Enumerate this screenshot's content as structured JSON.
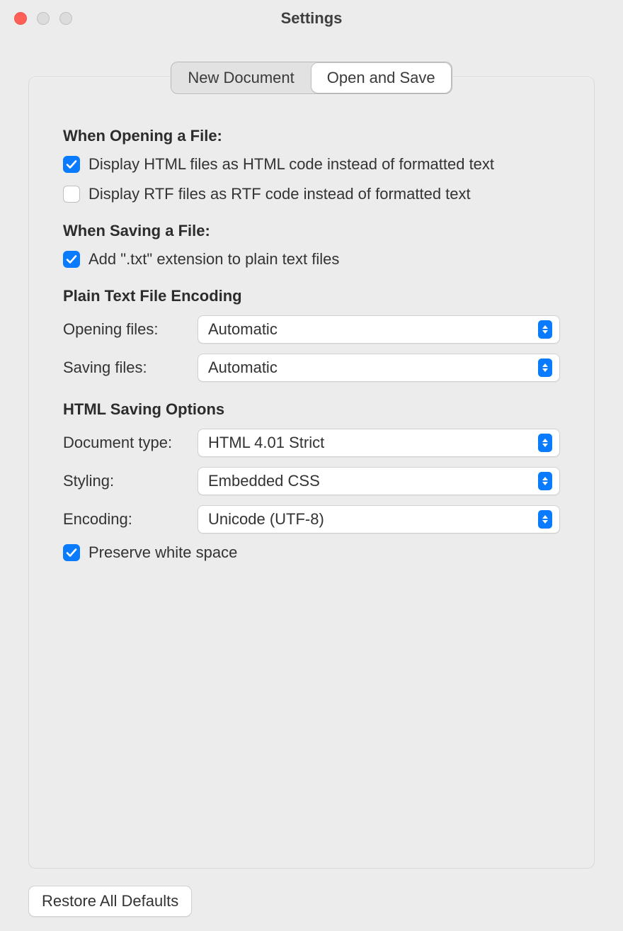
{
  "window": {
    "title": "Settings"
  },
  "tabs": {
    "new_document": "New Document",
    "open_and_save": "Open and Save"
  },
  "opening": {
    "heading": "When Opening a File:",
    "html_code_label": "Display HTML files as HTML code instead of formatted text",
    "html_code_checked": true,
    "rtf_code_label": "Display RTF files as RTF code instead of formatted text",
    "rtf_code_checked": false
  },
  "saving": {
    "heading": "When Saving a File:",
    "add_txt_label": "Add \".txt\" extension to plain text files",
    "add_txt_checked": true
  },
  "encoding": {
    "heading": "Plain Text File Encoding",
    "opening_label": "Opening files:",
    "opening_value": "Automatic",
    "saving_label": "Saving files:",
    "saving_value": "Automatic"
  },
  "html_opts": {
    "heading": "HTML Saving Options",
    "doctype_label": "Document type:",
    "doctype_value": "HTML 4.01 Strict",
    "styling_label": "Styling:",
    "styling_value": "Embedded CSS",
    "encoding_label": "Encoding:",
    "encoding_value": "Unicode (UTF-8)",
    "preserve_ws_label": "Preserve white space",
    "preserve_ws_checked": true
  },
  "footer": {
    "restore_label": "Restore All Defaults"
  }
}
